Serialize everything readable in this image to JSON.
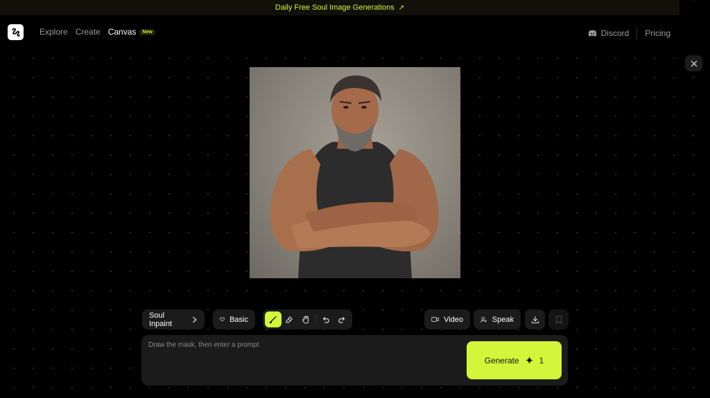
{
  "banner": {
    "text": "Daily Free Soul Image Generations",
    "arrow": "↗"
  },
  "nav": {
    "explore": "Explore",
    "create": "Create",
    "canvas": "Canvas",
    "new_badge": "New"
  },
  "header_right": {
    "discord": "Discord",
    "pricing": "Pricing"
  },
  "toolbar": {
    "model": "Soul Inpaint",
    "style": "Basic",
    "video": "Video",
    "speak": "Speak"
  },
  "prompt": {
    "placeholder": "Draw the mask, then enter a prompt",
    "generate_label": "Generate",
    "generate_count": "1"
  },
  "icons": [
    "logo-icon",
    "discord-icon",
    "close-icon",
    "chevron-right-icon",
    "heart-icon",
    "brush-icon",
    "eraser-icon",
    "hand-icon",
    "undo-icon",
    "redo-icon",
    "video-icon",
    "speak-icon",
    "download-icon",
    "bookmark-icon",
    "sparkle-icon"
  ],
  "colors": {
    "accent": "#d4f53a",
    "background": "#000000",
    "panel": "#1b1b1b"
  }
}
